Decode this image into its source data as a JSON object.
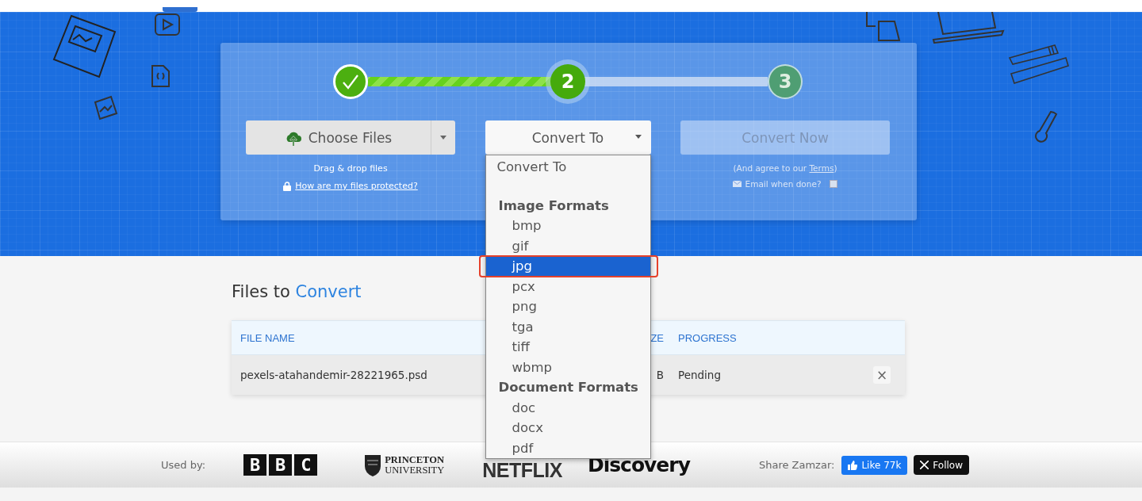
{
  "hero": {
    "steps": [
      {
        "completed": true,
        "current": false
      },
      {
        "completed": false,
        "current": true,
        "number": "2"
      },
      {
        "completed": false,
        "current": false,
        "number": "3"
      }
    ],
    "progress": {
      "level": 0.5
    },
    "choose_files": {
      "label": "Choose Files",
      "hint": "Drag & drop files",
      "link": "How are my files protected?"
    },
    "convert_to": {
      "label": "Convert To",
      "expanded": true
    },
    "convert_now": {
      "label": "Convert Now",
      "disabled": true,
      "note": "(And agree to our ",
      "terms_link": "Terms",
      "note_end": ")",
      "email_label": "Email when done?",
      "email_checked": false
    }
  },
  "dropdown": {
    "items": [
      {
        "kind": "option",
        "label": "Convert To",
        "selected": false,
        "outlined": false
      },
      {
        "kind": "spacer"
      },
      {
        "kind": "group",
        "label": "Image Formats"
      },
      {
        "kind": "option",
        "label": "bmp",
        "selected": false,
        "outlined": false
      },
      {
        "kind": "option",
        "label": "gif",
        "selected": false,
        "outlined": false
      },
      {
        "kind": "option",
        "label": "jpg",
        "selected": true,
        "outlined": true
      },
      {
        "kind": "option",
        "label": "pcx",
        "selected": false,
        "outlined": false
      },
      {
        "kind": "option",
        "label": "png",
        "selected": false,
        "outlined": false
      },
      {
        "kind": "option",
        "label": "tga",
        "selected": false,
        "outlined": false
      },
      {
        "kind": "option",
        "label": "tiff",
        "selected": false,
        "outlined": false
      },
      {
        "kind": "option",
        "label": "wbmp",
        "selected": false,
        "outlined": false
      },
      {
        "kind": "group",
        "label": "Document Formats"
      },
      {
        "kind": "option",
        "label": "doc",
        "selected": false,
        "outlined": false
      },
      {
        "kind": "option",
        "label": "docx",
        "selected": false,
        "outlined": false
      },
      {
        "kind": "option",
        "label": "pdf",
        "selected": false,
        "outlined": false
      }
    ]
  },
  "files": {
    "title": "Files to ",
    "title_accent": "Convert",
    "columns": [
      {
        "label": "FILE NAME"
      },
      {
        "label": "ZE"
      },
      {
        "label": "PROGRESS"
      }
    ],
    "rows": [
      {
        "file_name": "pexels-atahandemir-28221965.psd",
        "size": "B",
        "progress": "Pending",
        "remove": "×"
      }
    ]
  },
  "footer": {
    "used_by": "Used by:",
    "logos": [
      {
        "kind": "bbc",
        "text": "BBC"
      },
      {
        "kind": "princeton",
        "text": "PRINCETON",
        "text_2": "UNIVERSITY"
      },
      {
        "kind": "netflix",
        "text": "NETFLIX"
      },
      {
        "kind": "discovery",
        "text": "Discovery"
      }
    ],
    "share": "Share Zamzar:",
    "like": "Like 77k",
    "follow": "Follow"
  }
}
